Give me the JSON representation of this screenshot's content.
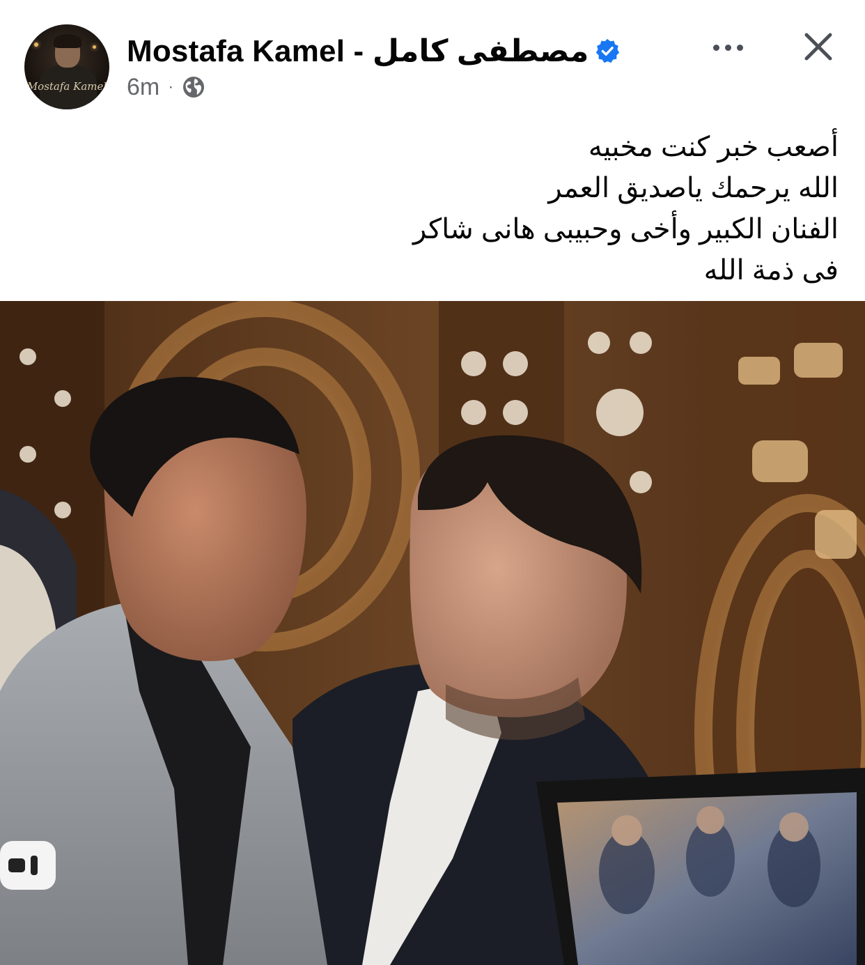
{
  "post": {
    "author": {
      "name": "Mostafa Kamel - مصطفى  كامل",
      "avatar_signature": "Mostafa Kamel",
      "verified": true,
      "verified_icon": "verified-badge-icon"
    },
    "timestamp": "6m",
    "separator": "·",
    "audience_icon": "globe-icon",
    "more_icon": "more-options-icon",
    "close_icon": "close-icon",
    "text_lines": [
      "أصعب خبر كنت مخبيه",
      "الله يرحمك ياصديق العمر",
      "الفنان الكبير وأخى وحبيبى هانى شاكر",
      "فى ذمة الله"
    ]
  },
  "colors": {
    "text_primary": "#050505",
    "text_secondary": "#65676b",
    "verified_blue": "#1877f2",
    "icon_gray": "#4b4f56"
  }
}
